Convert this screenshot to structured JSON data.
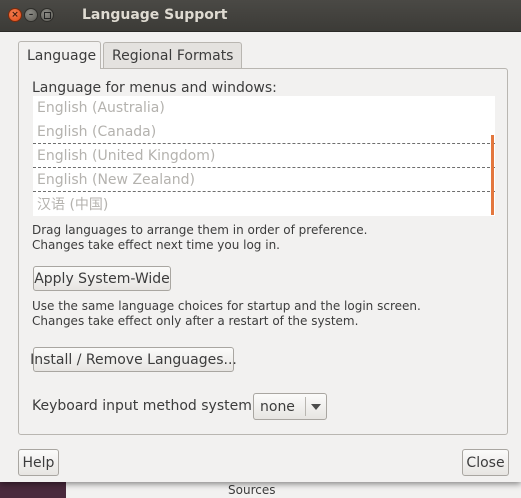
{
  "window": {
    "title": "Language Support"
  },
  "background": {
    "partial_text": "Sources"
  },
  "tabs": [
    {
      "label": "Language",
      "active": true
    },
    {
      "label": "Regional Formats",
      "active": false
    }
  ],
  "language_section": {
    "label": "Language for menus and windows:",
    "languages": [
      "English (Australia)",
      "English (Canada)",
      "English (United Kingdom)",
      "English (New Zealand)",
      "汉语 (中国)"
    ],
    "hint_line1": "Drag languages to arrange them in order of preference.",
    "hint_line2": "Changes take effect next time you log in."
  },
  "apply_button": "Apply System-Wide",
  "apply_note_line1": "Use the same language choices for startup and the login screen.",
  "apply_note_line2": "Changes take effect only after a restart of the system.",
  "install_button": "Install / Remove Languages...",
  "keyboard": {
    "label": "Keyboard input method system:",
    "value": "none"
  },
  "help_button": "Help",
  "close_button": "Close",
  "colors": {
    "accent": "#e3773e",
    "titlebar": "#3c3b37",
    "close_btn": "#df4a16"
  }
}
